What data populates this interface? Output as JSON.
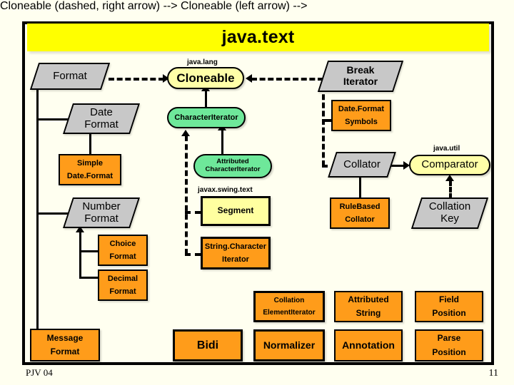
{
  "slide": {
    "title": "java.text",
    "footer_left": "PJV 04",
    "footer_right": "11",
    "colors": {
      "background": "#fffff0",
      "title_banner": "#ffff00",
      "abstract_class": "#c8c8c8",
      "concrete_class": "#ff9c1a",
      "interface_external": "#ffffa8",
      "interface_internal": "#6ee89a",
      "pale_class": "#ffffa0",
      "frame": "#000000"
    }
  },
  "packages": [
    {
      "id": "pkg-java-lang",
      "label": "java.lang"
    },
    {
      "id": "pkg-java-util",
      "label": "java.util"
    },
    {
      "id": "pkg-javax-swing-text",
      "label": "javax.swing.text"
    }
  ],
  "nodes": {
    "format": {
      "lines": [
        "Format"
      ],
      "kind": "abstract"
    },
    "cloneable": {
      "lines": [
        "Cloneable"
      ],
      "kind": "interface-external"
    },
    "break_iterator": {
      "lines": [
        "Break",
        "Iterator"
      ],
      "kind": "abstract"
    },
    "date_format": {
      "lines": [
        "Date",
        "Format"
      ],
      "kind": "abstract"
    },
    "character_iterator": {
      "lines": [
        "CharacterIterator"
      ],
      "kind": "interface-internal"
    },
    "date_format_symbols": {
      "lines": [
        "Date.Format",
        "Symbols"
      ],
      "kind": "concrete"
    },
    "simple_date_format": {
      "lines": [
        "Simple",
        "Date.Format"
      ],
      "kind": "concrete"
    },
    "attributed_character_iterator": {
      "lines": [
        "Attributed",
        "CharacterIterator"
      ],
      "kind": "interface-internal"
    },
    "collator": {
      "lines": [
        "Collator"
      ],
      "kind": "abstract"
    },
    "comparator": {
      "lines": [
        "Comparator"
      ],
      "kind": "interface-external"
    },
    "number_format": {
      "lines": [
        "Number",
        "Format"
      ],
      "kind": "abstract"
    },
    "segment": {
      "lines": [
        "Segment"
      ],
      "kind": "pale"
    },
    "rule_based_collator": {
      "lines": [
        "RuleBased",
        "Collator"
      ],
      "kind": "concrete"
    },
    "collation_key": {
      "lines": [
        "Collation",
        "Key"
      ],
      "kind": "abstract"
    },
    "choice_format": {
      "lines": [
        "Choice",
        "Format"
      ],
      "kind": "concrete"
    },
    "string_character_iterator": {
      "lines": [
        "String.Character",
        "Iterator"
      ],
      "kind": "concrete"
    },
    "decimal_format": {
      "lines": [
        "Decimal",
        "Format"
      ],
      "kind": "concrete"
    },
    "collation_element_iterator": {
      "lines": [
        "Collation",
        "ElementIterator"
      ],
      "kind": "concrete"
    },
    "attributed_string": {
      "lines": [
        "Attributed",
        "String"
      ],
      "kind": "concrete"
    },
    "field_position": {
      "lines": [
        "Field",
        "Position"
      ],
      "kind": "concrete"
    },
    "message_format": {
      "lines": [
        "Message",
        "Format"
      ],
      "kind": "concrete"
    },
    "bidi": {
      "lines": [
        "Bidi"
      ],
      "kind": "concrete"
    },
    "normalizer": {
      "lines": [
        "Normalizer"
      ],
      "kind": "concrete"
    },
    "annotation": {
      "lines": [
        "Annotation"
      ],
      "kind": "concrete"
    },
    "parse_position": {
      "lines": [
        "Parse",
        "Position"
      ],
      "kind": "concrete"
    }
  },
  "relations": [
    {
      "from": "format",
      "to": "cloneable",
      "style": "dashed",
      "kind": "realization"
    },
    {
      "from": "break_iterator",
      "to": "cloneable",
      "style": "dashed",
      "kind": "realization"
    },
    {
      "from": "character_iterator",
      "to": "cloneable",
      "style": "solid",
      "kind": "generalization"
    },
    {
      "from": "date_format",
      "to": "format",
      "style": "solid",
      "kind": "generalization"
    },
    {
      "from": "number_format",
      "to": "format",
      "style": "solid",
      "kind": "generalization"
    },
    {
      "from": "message_format",
      "to": "format",
      "style": "solid",
      "kind": "generalization"
    },
    {
      "from": "simple_date_format",
      "to": "date_format",
      "style": "solid",
      "kind": "generalization"
    },
    {
      "from": "attributed_character_iterator",
      "to": "character_iterator",
      "style": "solid",
      "kind": "generalization"
    },
    {
      "from": "segment",
      "to": "character_iterator",
      "style": "dashed",
      "kind": "realization"
    },
    {
      "from": "string_character_iterator",
      "to": "character_iterator",
      "style": "dashed",
      "kind": "realization"
    },
    {
      "from": "date_format_symbols",
      "to": "cloneable",
      "style": "dashed",
      "kind": "realization"
    },
    {
      "from": "collator",
      "to": "cloneable",
      "style": "dashed",
      "kind": "realization"
    },
    {
      "from": "collator",
      "to": "comparator",
      "style": "solid",
      "kind": "generalization"
    },
    {
      "from": "rule_based_collator",
      "to": "collator",
      "style": "solid",
      "kind": "generalization"
    },
    {
      "from": "collation_key",
      "to": "comparator",
      "style": "dashed",
      "kind": "realization"
    },
    {
      "from": "choice_format",
      "to": "number_format",
      "style": "solid",
      "kind": "generalization"
    },
    {
      "from": "decimal_format",
      "to": "number_format",
      "style": "solid",
      "kind": "generalization"
    }
  ]
}
